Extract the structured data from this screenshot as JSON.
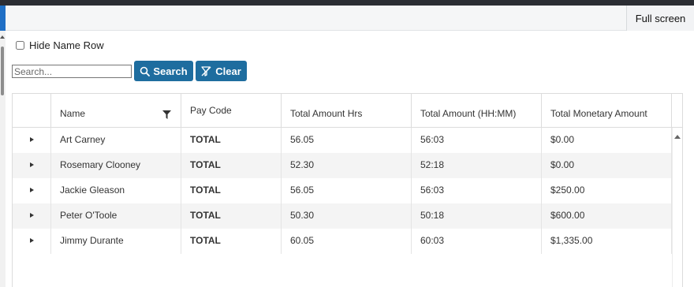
{
  "toolbar": {
    "fullscreen_label": "Full screen"
  },
  "controls": {
    "hide_name_row_label": "Hide Name Row",
    "hide_name_row_checked": false,
    "search_placeholder": "Search...",
    "search_value": "",
    "search_button": "Search",
    "clear_button": "Clear",
    "button_color": "#1e6d9f"
  },
  "grid": {
    "columns": [
      "Name",
      "Pay Code",
      "Total Amount Hrs",
      "Total Amount (HH:MM)",
      "Total Monetary Amount"
    ],
    "rows": [
      {
        "name": "Art Carney",
        "pay_code": "TOTAL",
        "hrs": "56.05",
        "hhmm": "56:03",
        "money": "$0.00"
      },
      {
        "name": "Rosemary Clooney",
        "pay_code": "TOTAL",
        "hrs": "52.30",
        "hhmm": "52:18",
        "money": "$0.00"
      },
      {
        "name": "Jackie Gleason",
        "pay_code": "TOTAL",
        "hrs": "56.05",
        "hhmm": "56:03",
        "money": "$250.00"
      },
      {
        "name": "Peter O'Toole",
        "pay_code": "TOTAL",
        "hrs": "50.30",
        "hhmm": "50:18",
        "money": "$600.00"
      },
      {
        "name": "Jimmy Durante",
        "pay_code": "TOTAL",
        "hrs": "60.05",
        "hhmm": "60:03",
        "money": "$1,335.00"
      }
    ]
  },
  "icons": {
    "expand": "triangle-right-icon",
    "filter": "filter-icon",
    "search": "search-icon",
    "clear": "clear-filter-icon"
  }
}
